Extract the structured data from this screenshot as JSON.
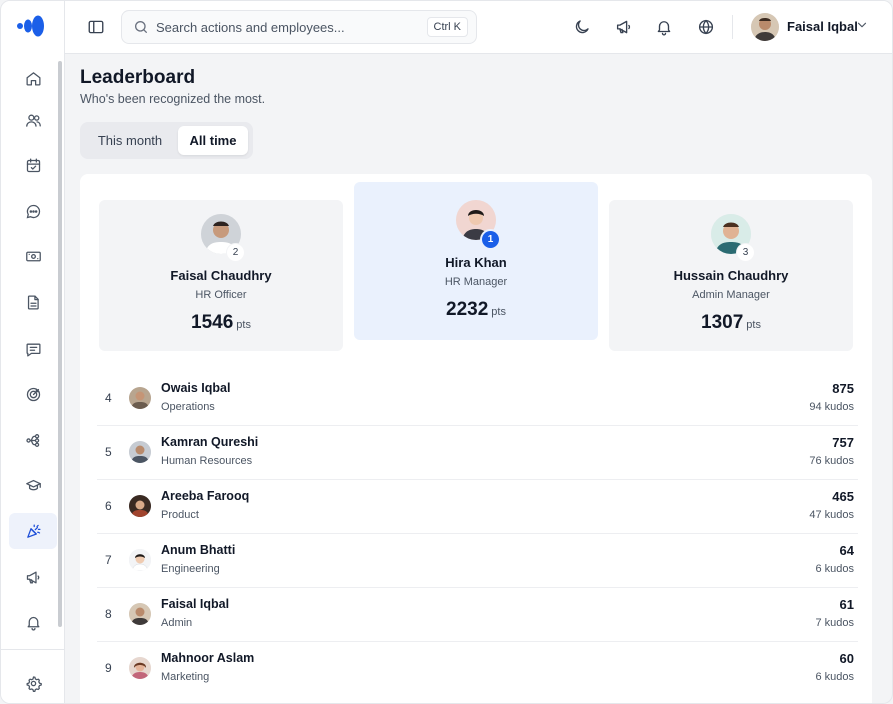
{
  "header": {
    "search_placeholder": "Search actions and employees...",
    "search_shortcut": "Ctrl K",
    "user_name": "Faisal Iqbal"
  },
  "sidebar": {
    "items": [
      {
        "icon": "home-icon",
        "active": false
      },
      {
        "icon": "users-icon",
        "active": false
      },
      {
        "icon": "calendar-check-icon",
        "active": false
      },
      {
        "icon": "chat-icon",
        "active": false
      },
      {
        "icon": "money-icon",
        "active": false
      },
      {
        "icon": "document-icon",
        "active": false
      },
      {
        "icon": "message-square-icon",
        "active": false
      },
      {
        "icon": "target-icon",
        "active": false
      },
      {
        "icon": "workflow-icon",
        "active": false
      },
      {
        "icon": "graduation-cap-icon",
        "active": false
      },
      {
        "icon": "party-popper-icon",
        "active": true
      },
      {
        "icon": "megaphone-icon",
        "active": false
      },
      {
        "icon": "bell-icon",
        "active": false
      }
    ],
    "footer_icon": "settings-icon"
  },
  "page": {
    "title": "Leaderboard",
    "subtitle": "Who's been recognized the most.",
    "tabs": [
      {
        "label": "This month",
        "active": false
      },
      {
        "label": "All time",
        "active": true
      }
    ]
  },
  "podium": [
    {
      "rank": "2",
      "name": "Faisal Chaudhry",
      "role": "HR Officer",
      "points": "1546",
      "unit": "pts"
    },
    {
      "rank": "1",
      "name": "Hira Khan",
      "role": "HR Manager",
      "points": "2232",
      "unit": "pts"
    },
    {
      "rank": "3",
      "name": "Hussain Chaudhry",
      "role": "Admin Manager",
      "points": "1307",
      "unit": "pts"
    }
  ],
  "rows": [
    {
      "rank": "4",
      "name": "Owais Iqbal",
      "dept": "Operations",
      "points": "875",
      "kudos": "94 kudos"
    },
    {
      "rank": "5",
      "name": "Kamran Qureshi",
      "dept": "Human Resources",
      "points": "757",
      "kudos": "76 kudos"
    },
    {
      "rank": "6",
      "name": "Areeba Farooq",
      "dept": "Product",
      "points": "465",
      "kudos": "47 kudos"
    },
    {
      "rank": "7",
      "name": "Anum Bhatti",
      "dept": "Engineering",
      "points": "64",
      "kudos": "6 kudos"
    },
    {
      "rank": "8",
      "name": "Faisal Iqbal",
      "dept": "Admin",
      "points": "61",
      "kudos": "7 kudos"
    },
    {
      "rank": "9",
      "name": "Mahnoor Aslam",
      "dept": "Marketing",
      "points": "60",
      "kudos": "6 kudos"
    }
  ],
  "colors": {
    "accent": "#1b5fe8",
    "active_nav_bg": "#eef2fb",
    "first_place_bg": "#eaf1fd"
  }
}
